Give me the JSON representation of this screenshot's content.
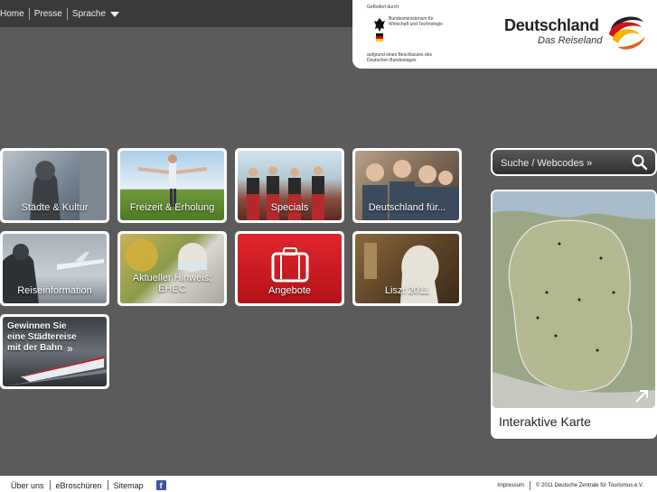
{
  "topnav": {
    "home": "Home",
    "presse": "Presse",
    "sprache": "Sprache"
  },
  "logo": {
    "gefoerdert": "Gefördert durch:",
    "ministry": "Bundesministerium für Wirtschaft und Technologie",
    "beschluss": "aufgrund eines Beschlusses des Deutschen Bundestages",
    "brand": "Deutschland",
    "tagline": "Das Reiseland"
  },
  "tiles": [
    {
      "label": "Städte & Kultur"
    },
    {
      "label": "Freizeit & Erholung"
    },
    {
      "label": "Specials"
    },
    {
      "label": "Deutschland für..."
    },
    {
      "label": "Reiseinformation"
    },
    {
      "label": "Aktueller Hinweis: EHEC"
    },
    {
      "label": "Angebote"
    },
    {
      "label": "Liszt 2011"
    },
    {
      "label": "Gewinnen Sie eine Städtereise mit der Bahn"
    }
  ],
  "search": {
    "label": "Suche / Webcodes »"
  },
  "map": {
    "label": "Interaktive Karte"
  },
  "footer": {
    "ueber_uns": "Über uns",
    "ebroschueren": "eBroschüren",
    "sitemap": "Sitemap",
    "impressum": "Impressum",
    "copyright": "© 2011 Deutsche Zentrale für Tourismus e.V."
  },
  "colors": {
    "background": "#5b5b5b",
    "topbar": "#3a3a3a",
    "angebote_red": "#c4161c",
    "facebook": "#3b5998"
  }
}
